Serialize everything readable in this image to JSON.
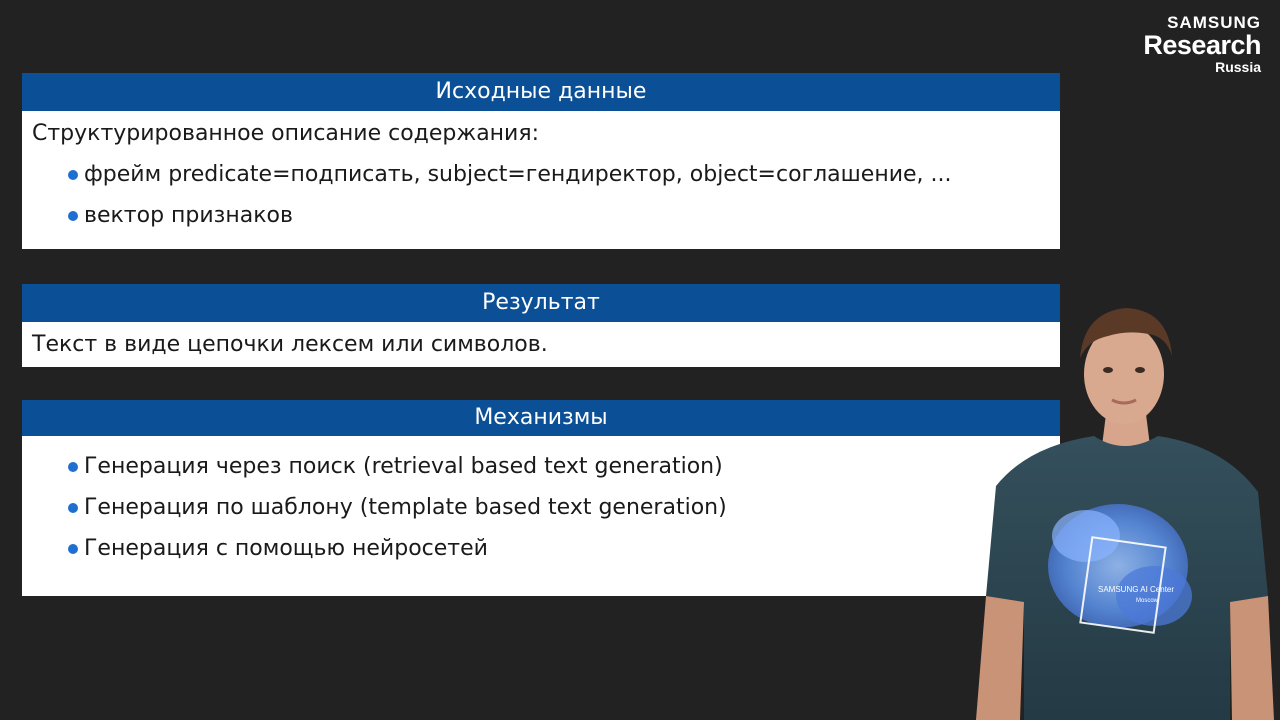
{
  "logo": {
    "brand": "SAMSUNG",
    "research": "Research",
    "region": "Russia"
  },
  "blocks": [
    {
      "title": "Исходные данные",
      "intro": "Структурированное описание содержания:",
      "items": [
        "фрейм predicate=подписать, subject=гендиректор, object=соглашение, ...",
        "вектор признаков"
      ]
    },
    {
      "title": "Результат",
      "intro": "Текст в виде цепочки лексем или символов."
    },
    {
      "title": "Механизмы",
      "items": [
        "Генерация через поиск (retrieval based text generation)",
        "Генерация по шаблону (template based text generation)",
        "Генерация с помощью нейросетей"
      ]
    }
  ],
  "presenter": {
    "shirt_logo": "SAMSUNG AI Center",
    "shirt_sub": "Moscow"
  },
  "colors": {
    "background": "#222222",
    "header": "#0b4f96",
    "bullet": "#1f6fd1",
    "shirt": "#2d4450"
  }
}
